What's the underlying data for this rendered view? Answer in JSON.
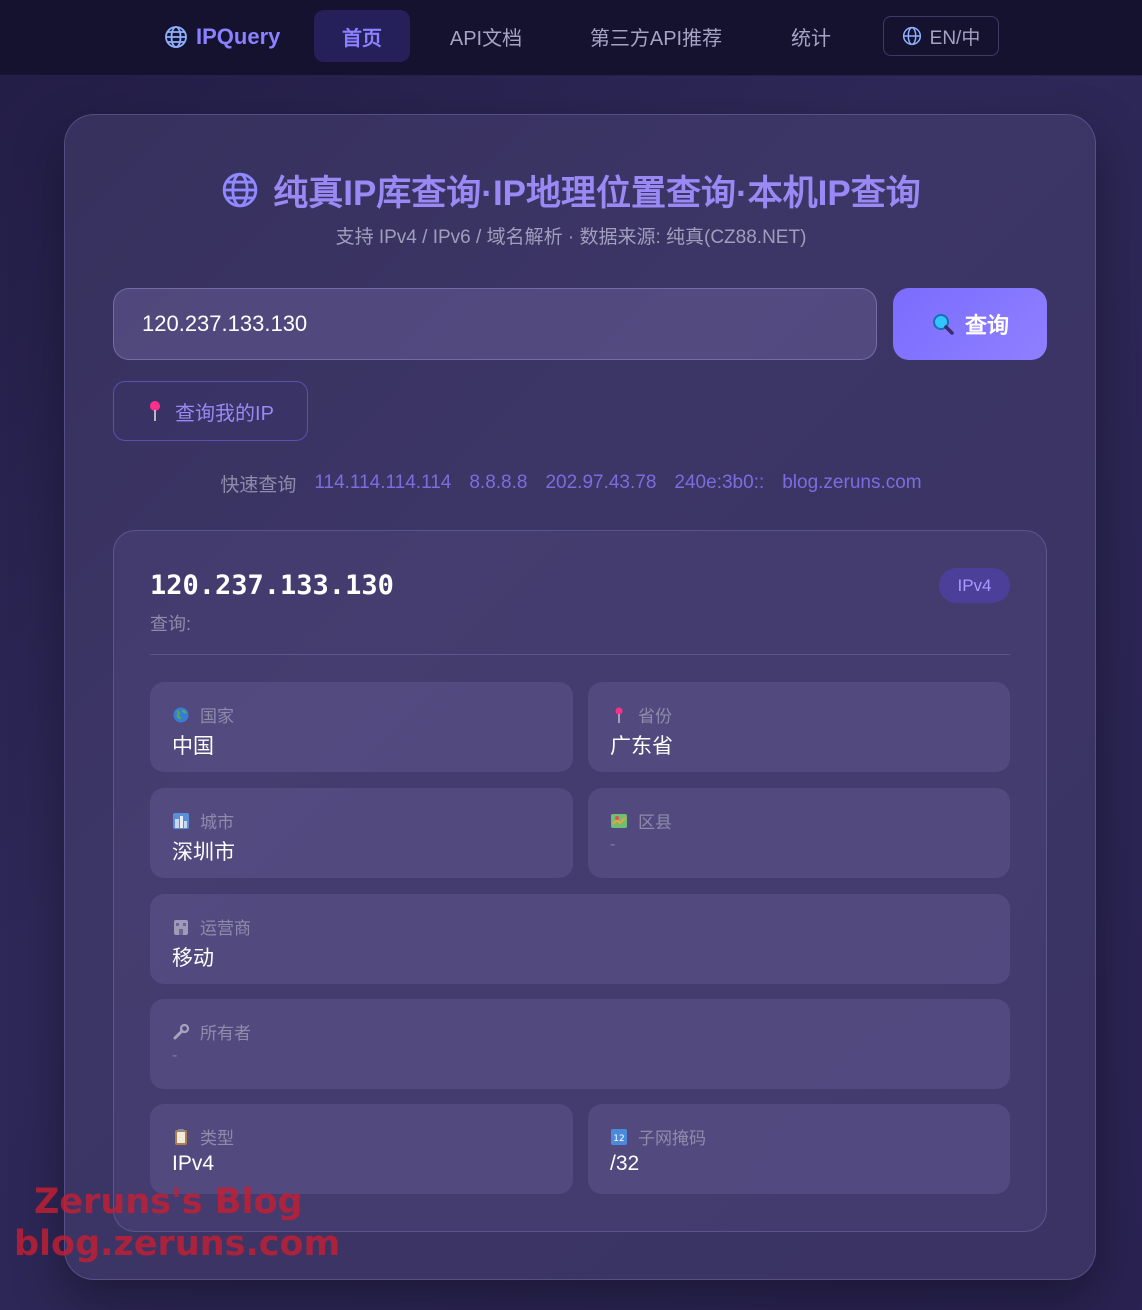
{
  "nav": {
    "brand": "IPQuery",
    "items": [
      {
        "label": "首页",
        "active": true
      },
      {
        "label": "API文档"
      },
      {
        "label": "第三方API推荐"
      },
      {
        "label": "统计"
      }
    ],
    "lang": "EN/中"
  },
  "header": {
    "title": "纯真IP库查询·IP地理位置查询·本机IP查询",
    "subtitle": "支持 IPv4 / IPv6 / 域名解析 · 数据来源: 纯真(CZ88.NET)"
  },
  "search": {
    "value": "120.237.133.130",
    "button_label": "查询",
    "my_ip_label": "查询我的IP"
  },
  "quick": {
    "label": "快速查询",
    "links": [
      "114.114.114.114",
      "8.8.8.8",
      "202.97.43.78",
      "240e:3b0::",
      "blog.zeruns.com"
    ]
  },
  "result": {
    "ip": "120.237.133.130",
    "query_label": "查询:",
    "badge": "IPv4",
    "fields": {
      "country": {
        "label": "国家",
        "value": "中国"
      },
      "province": {
        "label": "省份",
        "value": "广东省"
      },
      "city": {
        "label": "城市",
        "value": "深圳市"
      },
      "district": {
        "label": "区县",
        "value": "-"
      },
      "isp": {
        "label": "运营商",
        "value": "移动"
      },
      "owner": {
        "label": "所有者",
        "value": "-"
      },
      "type": {
        "label": "类型",
        "value": "IPv4"
      },
      "netmask": {
        "label": "子网掩码",
        "value": "/32"
      }
    }
  },
  "watermark": {
    "line1": "Zeruns's Blog",
    "line2": "blog.zeruns.com"
  },
  "colors": {
    "accent": "#8b80ff",
    "background": "#2a2352",
    "nav_bg": "#151230"
  }
}
